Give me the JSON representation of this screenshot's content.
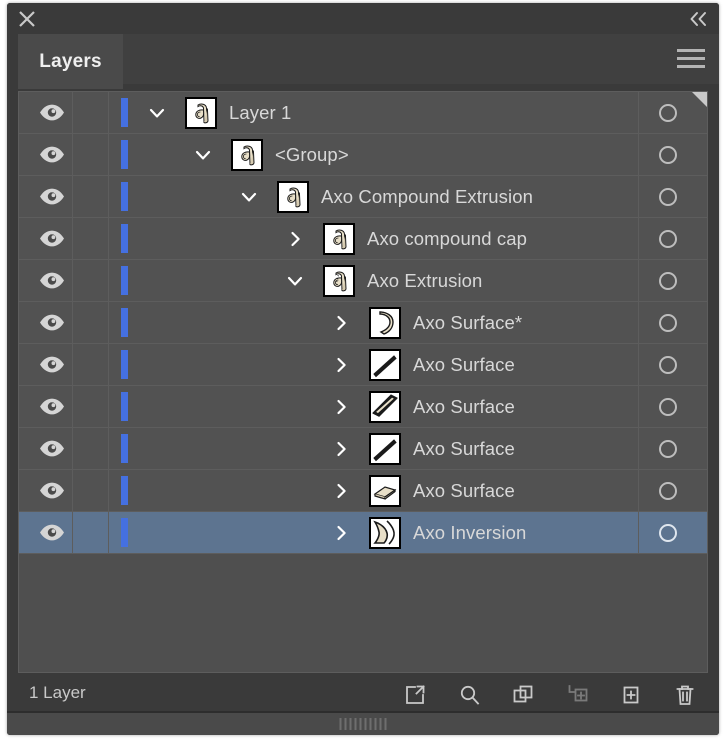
{
  "window": {
    "close_icon": "close-icon",
    "collapse_icon": "collapse-double-chevron-icon",
    "menu_icon": "hamburger-menu-icon"
  },
  "tabs": [
    {
      "label": "Layers",
      "active": true
    }
  ],
  "colors": {
    "panel_bg": "#3a3a3a",
    "tab_active_bg": "#4a4a4a",
    "row_bg": "#525252",
    "row_selected_bg": "#5d7490",
    "layer_color_bar": "#4570e0",
    "text": "#d8d8d8",
    "divider": "#5d5d5d"
  },
  "layers": [
    {
      "name": "Layer 1",
      "indent": 0,
      "disclosure": "expanded",
      "thumb": "glyph-a",
      "visible": true,
      "selected": false,
      "target": "circle"
    },
    {
      "name": "<Group>",
      "indent": 1,
      "disclosure": "expanded",
      "thumb": "glyph-a",
      "visible": true,
      "selected": false,
      "target": "circle"
    },
    {
      "name": "Axo Compound Extrusion",
      "indent": 2,
      "disclosure": "expanded",
      "thumb": "glyph-a",
      "visible": true,
      "selected": false,
      "target": "circle"
    },
    {
      "name": "Axo compound cap",
      "indent": 3,
      "disclosure": "collapsed",
      "thumb": "glyph-a-cap",
      "visible": true,
      "selected": false,
      "target": "circle"
    },
    {
      "name": "Axo Extrusion",
      "indent": 3,
      "disclosure": "expanded",
      "thumb": "glyph-a-extrusion",
      "visible": true,
      "selected": false,
      "target": "circle"
    },
    {
      "name": "Axo Surface*",
      "indent": 4,
      "disclosure": "collapsed",
      "thumb": "surface-curve",
      "visible": true,
      "selected": false,
      "target": "circle"
    },
    {
      "name": "Axo Surface",
      "indent": 4,
      "disclosure": "collapsed",
      "thumb": "surface-thin-diagonal",
      "visible": true,
      "selected": false,
      "target": "circle"
    },
    {
      "name": "Axo Surface",
      "indent": 4,
      "disclosure": "collapsed",
      "thumb": "surface-thick-diagonal",
      "visible": true,
      "selected": false,
      "target": "circle"
    },
    {
      "name": "Axo Surface",
      "indent": 4,
      "disclosure": "collapsed",
      "thumb": "surface-thin-diagonal",
      "visible": true,
      "selected": false,
      "target": "circle"
    },
    {
      "name": "Axo Surface",
      "indent": 4,
      "disclosure": "collapsed",
      "thumb": "surface-parallelogram",
      "visible": true,
      "selected": false,
      "target": "circle"
    },
    {
      "name": "Axo Inversion",
      "indent": 4,
      "disclosure": "collapsed",
      "thumb": "surface-inversion",
      "visible": true,
      "selected": true,
      "target": "circle"
    }
  ],
  "footer": {
    "layer_count": "1 Layer",
    "tools": [
      {
        "name": "release-to-layers-icon",
        "enabled": true
      },
      {
        "name": "locate-object-icon",
        "enabled": true
      },
      {
        "name": "make-clipping-mask-icon",
        "enabled": true
      },
      {
        "name": "create-new-sublayer-icon",
        "enabled": false
      },
      {
        "name": "create-new-layer-icon",
        "enabled": true
      },
      {
        "name": "delete-selection-icon",
        "enabled": true
      }
    ]
  }
}
